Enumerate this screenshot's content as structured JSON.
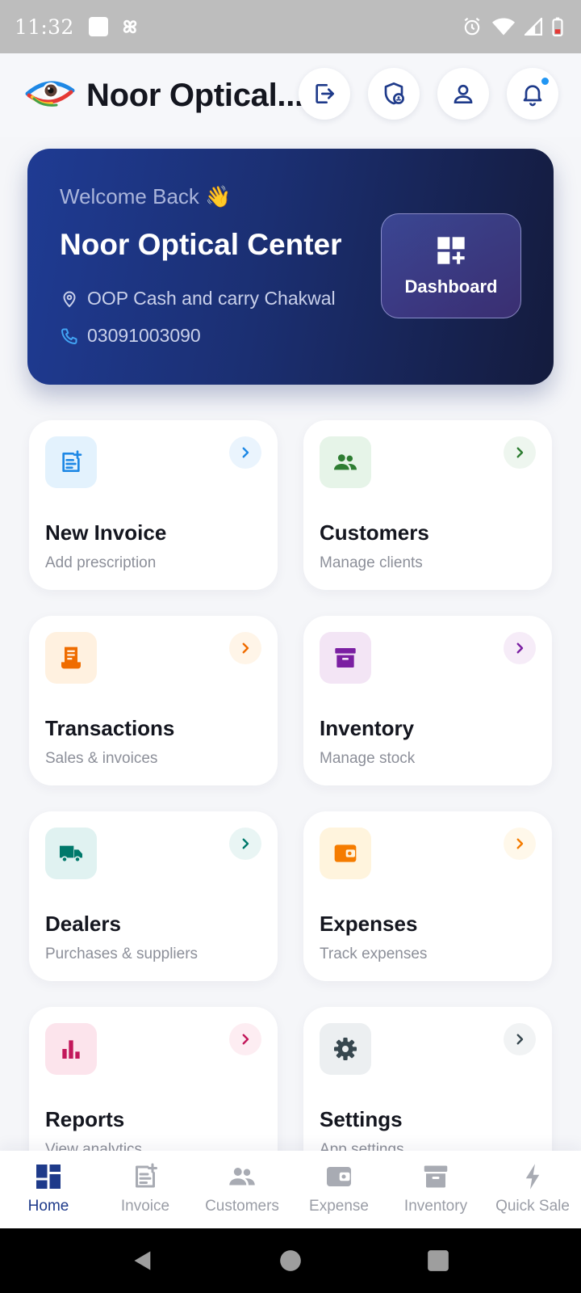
{
  "status_bar": {
    "time": "11:32"
  },
  "header": {
    "title": "Noor Optical..."
  },
  "welcome": {
    "greeting": "Welcome Back 👋",
    "shop_name": "Noor Optical Center",
    "address": "OOP Cash and carry Chakwal",
    "phone": "03091003090",
    "dashboard_label": "Dashboard"
  },
  "menu": [
    {
      "title": "New Invoice",
      "subtitle": "Add prescription",
      "icon": "invoice-icon",
      "color": "#1e88e5",
      "bg": "#e3f2fd"
    },
    {
      "title": "Customers",
      "subtitle": "Manage clients",
      "icon": "people-icon",
      "color": "#2e7d32",
      "bg": "#e6f4e8"
    },
    {
      "title": "Transactions",
      "subtitle": "Sales & invoices",
      "icon": "receipt-icon",
      "color": "#ef6c00",
      "bg": "#fff1e0"
    },
    {
      "title": "Inventory",
      "subtitle": "Manage stock",
      "icon": "archive-icon",
      "color": "#7b1fa2",
      "bg": "#f3e5f5"
    },
    {
      "title": "Dealers",
      "subtitle": "Purchases & suppliers",
      "icon": "truck-icon",
      "color": "#00796b",
      "bg": "#e0f2f1"
    },
    {
      "title": "Expenses",
      "subtitle": "Track expenses",
      "icon": "wallet-icon",
      "color": "#f57c00",
      "bg": "#fff4dd"
    },
    {
      "title": "Reports",
      "subtitle": "View analytics",
      "icon": "bar-chart-icon",
      "color": "#c2185b",
      "bg": "#fce4ec"
    },
    {
      "title": "Settings",
      "subtitle": "App settings",
      "icon": "gear-icon",
      "color": "#37474f",
      "bg": "#eceff1"
    }
  ],
  "bottom_nav": [
    {
      "label": "Home",
      "icon": "dashboard-icon"
    },
    {
      "label": "Invoice",
      "icon": "invoice-icon"
    },
    {
      "label": "Customers",
      "icon": "people-icon"
    },
    {
      "label": "Expense",
      "icon": "wallet-icon"
    },
    {
      "label": "Inventory",
      "icon": "archive-icon"
    },
    {
      "label": "Quick Sale",
      "icon": "bolt-icon"
    }
  ],
  "colors": {
    "primary": "#1e3a8a",
    "inactive": "#9a9da6",
    "notification_dot": "#2196f3"
  }
}
